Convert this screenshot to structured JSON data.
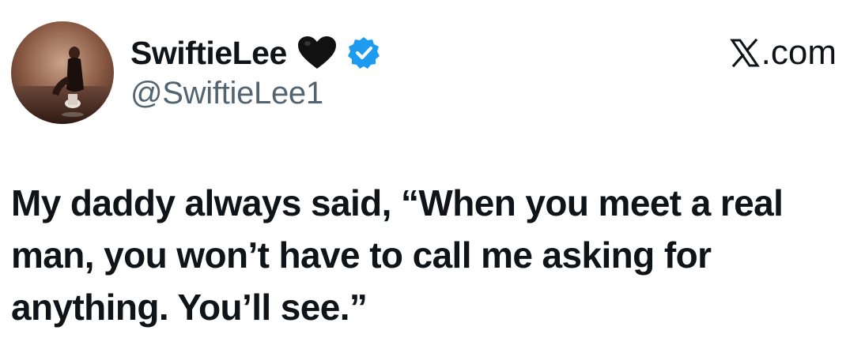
{
  "author": {
    "display_name": "SwiftieLee",
    "handle": "@SwiftieLee1",
    "name_emoji_icon": "black-heart-icon",
    "badge_icon": "verified-badge-icon",
    "verified_color": "#1d9bf0"
  },
  "source": {
    "logo_icon": "x-logo-icon",
    "label": ".com"
  },
  "tweet": {
    "text": "My daddy always said, “When you meet a real man, you won’t have to call me asking for anything. You’ll see.”"
  },
  "colors": {
    "text_primary": "#0f1419",
    "text_secondary": "#536471",
    "background": "#ffffff"
  }
}
